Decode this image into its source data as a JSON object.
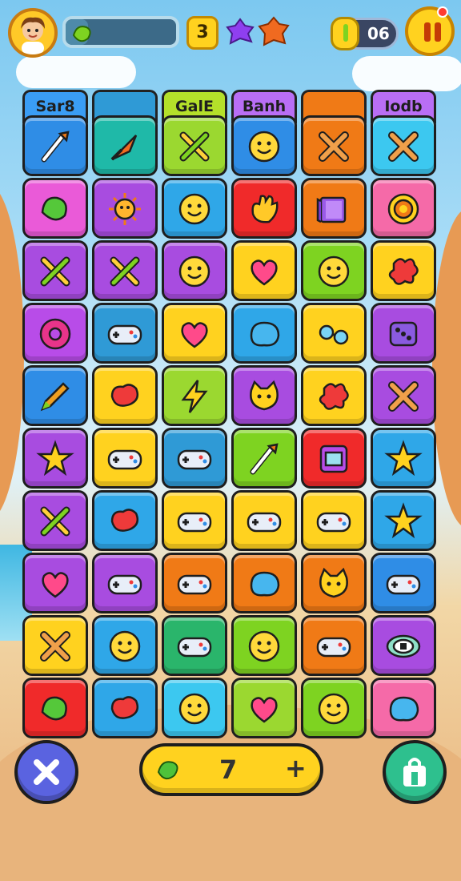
{
  "hud": {
    "level": "3",
    "coins": "06",
    "progress_fraction": 0.2,
    "avatar_icon": "player-avatar",
    "progress_icon": "leaf-gem-icon",
    "extra_icons": [
      "purple-gem-icon",
      "orange-gem-icon"
    ],
    "coin_icon": "coin-bar-icon",
    "pause_icon": "pause-icon"
  },
  "board": {
    "headers": [
      {
        "label": "Sar8",
        "color": "#3a9df5"
      },
      {
        "label": "",
        "color": "#2f9ad6"
      },
      {
        "label": "GalE",
        "color": "#b4e02a"
      },
      {
        "label": "Banh",
        "color": "#b96ef5"
      },
      {
        "label": "",
        "color": "#f07a16"
      },
      {
        "label": "Iodb",
        "color": "#b96ef5"
      }
    ],
    "rows": [
      [
        {
          "c": "#2f8de6",
          "i": "brush-icon"
        },
        {
          "c": "#1fb9a8",
          "i": "arrow-icon"
        },
        {
          "c": "#9bd830",
          "i": "crossed-sticks-icon"
        },
        {
          "c": "#2f8de6",
          "i": "smiley-icon"
        },
        {
          "c": "#f07a16",
          "i": "cross-icon"
        },
        {
          "c": "#3cc8f0",
          "i": "cross-icon"
        }
      ],
      [
        {
          "c": "#ea5ad8",
          "i": "leaf-icon"
        },
        {
          "c": "#a84ce0",
          "i": "sun-icon"
        },
        {
          "c": "#2fa7e8",
          "i": "smiley-icon"
        },
        {
          "c": "#f02a2a",
          "i": "hand-icon"
        },
        {
          "c": "#f07a16",
          "i": "book-icon"
        },
        {
          "c": "#f56aa8",
          "i": "target-icon"
        }
      ],
      [
        {
          "c": "#a84ce0",
          "i": "crossed-sticks-icon"
        },
        {
          "c": "#a84ce0",
          "i": "crossed-sticks-icon"
        },
        {
          "c": "#a84ce0",
          "i": "smiley-icon"
        },
        {
          "c": "#ffd21f",
          "i": "heart-icon"
        },
        {
          "c": "#7ed321",
          "i": "smiley-icon"
        },
        {
          "c": "#ffd21f",
          "i": "splat-icon"
        }
      ],
      [
        {
          "c": "#b84ce8",
          "i": "donut-icon"
        },
        {
          "c": "#2f9ad6",
          "i": "gamepad-icon"
        },
        {
          "c": "#ffd21f",
          "i": "heart-icon"
        },
        {
          "c": "#2fa7e8",
          "i": "blob-icon"
        },
        {
          "c": "#ffd21f",
          "i": "glasses-icon"
        },
        {
          "c": "#a84ce0",
          "i": "dice-icon"
        }
      ],
      [
        {
          "c": "#2f8de6",
          "i": "pencil-icon"
        },
        {
          "c": "#ffd21f",
          "i": "bean-icon"
        },
        {
          "c": "#9bd830",
          "i": "lightning-icon"
        },
        {
          "c": "#a84ce0",
          "i": "cat-icon"
        },
        {
          "c": "#ffd21f",
          "i": "splat-icon"
        },
        {
          "c": "#a84ce0",
          "i": "cross-icon"
        }
      ],
      [
        {
          "c": "#a84ce0",
          "i": "star-icon"
        },
        {
          "c": "#ffd21f",
          "i": "gamepad-icon"
        },
        {
          "c": "#2f9ad6",
          "i": "gamepad-icon"
        },
        {
          "c": "#7ed321",
          "i": "brush-icon"
        },
        {
          "c": "#f02a2a",
          "i": "box-icon"
        },
        {
          "c": "#2fa7e8",
          "i": "star-icon"
        }
      ],
      [
        {
          "c": "#a84ce0",
          "i": "crossed-sticks-icon"
        },
        {
          "c": "#2fa7e8",
          "i": "bean-icon"
        },
        {
          "c": "#ffd21f",
          "i": "gamepad-icon"
        },
        {
          "c": "#ffd21f",
          "i": "gamepad-icon"
        },
        {
          "c": "#ffd21f",
          "i": "gamepad-icon"
        },
        {
          "c": "#2fa7e8",
          "i": "star-icon"
        }
      ],
      [
        {
          "c": "#a84ce0",
          "i": "heart-icon"
        },
        {
          "c": "#a84ce0",
          "i": "gamepad-icon"
        },
        {
          "c": "#f07a16",
          "i": "gamepad-icon"
        },
        {
          "c": "#f07a16",
          "i": "blob-icon"
        },
        {
          "c": "#f07a16",
          "i": "cat-icon"
        },
        {
          "c": "#2f8de6",
          "i": "gamepad-icon"
        }
      ],
      [
        {
          "c": "#ffd21f",
          "i": "cross-icon"
        },
        {
          "c": "#2fa7e8",
          "i": "smiley-icon"
        },
        {
          "c": "#2ab56b",
          "i": "gamepad-icon"
        },
        {
          "c": "#7ed321",
          "i": "smiley-icon"
        },
        {
          "c": "#f07a16",
          "i": "gamepad-icon"
        },
        {
          "c": "#a84ce0",
          "i": "eye-icon"
        }
      ],
      [
        {
          "c": "#f02a2a",
          "i": "leaf-icon"
        },
        {
          "c": "#2fa7e8",
          "i": "bean-icon"
        },
        {
          "c": "#3cc8f0",
          "i": "smiley-icon"
        },
        {
          "c": "#9bd830",
          "i": "heart-icon"
        },
        {
          "c": "#7ed321",
          "i": "smiley-icon"
        },
        {
          "c": "#f56aa8",
          "i": "blob-icon"
        }
      ]
    ]
  },
  "bottom": {
    "counter_value": "7",
    "plus_label": "+",
    "close_icon": "close-icon",
    "shop_icon": "shopping-bag-icon",
    "counter_icon": "leaf-gem-icon"
  }
}
